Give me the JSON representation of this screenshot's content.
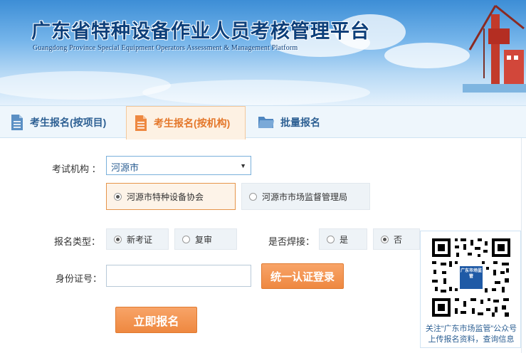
{
  "banner": {
    "title": "广东省特种设备作业人员考核管理平台",
    "subtitle": "Guangdong Province Special Equipment Operators Assessment & Management Platform"
  },
  "tabs": [
    {
      "label": "考生报名(按项目)",
      "icon": "document-icon",
      "active": false
    },
    {
      "label": "考生报名(按机构)",
      "icon": "document-icon",
      "active": true
    },
    {
      "label": "批量报名",
      "icon": "folder-icon",
      "active": false
    }
  ],
  "form": {
    "org_label": "考试机构 ：",
    "org_selected": "河源市",
    "org_options": [
      {
        "label": "河源市特种设备协会",
        "checked": true
      },
      {
        "label": "河源市市场监督管理局",
        "checked": false
      }
    ],
    "type_label": "报名类型：",
    "type_options": [
      {
        "label": "新考证",
        "checked": true
      },
      {
        "label": "复审",
        "checked": false
      }
    ],
    "weld_label": "是否焊接：",
    "weld_options": [
      {
        "label": "是",
        "checked": false
      },
      {
        "label": "否",
        "checked": true
      }
    ],
    "id_label": "身份证号：",
    "id_value": "",
    "auth_button": "统一认证登录",
    "submit_button": "立即报名"
  },
  "qr": {
    "center_text": "广东市场监管",
    "caption_line1": "关注“广东市场监管”公众号",
    "caption_line2": "上传报名资料，查询信息"
  },
  "colors": {
    "accent": "#ee8840",
    "link_blue": "#2c5f93",
    "tab_bar_bg": "#eef6fc"
  }
}
